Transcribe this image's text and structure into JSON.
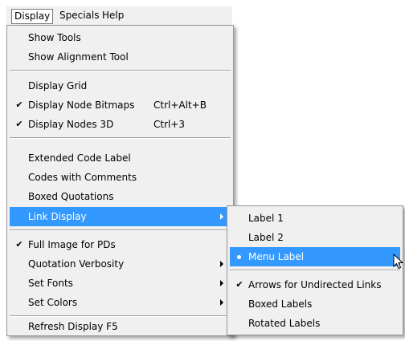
{
  "menubar": {
    "display": "Display",
    "specials": "Specials",
    "help": "Help"
  },
  "display_menu": {
    "show_tools": "Show Tools",
    "show_alignment_tool": "Show Alignment Tool",
    "display_grid": "Display Grid",
    "display_node_bitmaps": {
      "label": "Display Node Bitmaps",
      "accel": "Ctrl+Alt+B",
      "checked": true
    },
    "display_nodes_3d": {
      "label": "Display Nodes 3D",
      "accel": "Ctrl+3",
      "checked": true
    },
    "extended_code_label": "Extended Code Label",
    "codes_with_comments": "Codes with Comments",
    "boxed_quotations": "Boxed Quotations",
    "link_display": "Link Display",
    "full_image_for_pds": {
      "label": "Full Image for PDs",
      "checked": true
    },
    "quotation_verbosity": "Quotation Verbosity",
    "set_fonts": "Set Fonts",
    "set_colors": "Set Colors",
    "refresh_display": "Refresh Display  F5"
  },
  "link_display_submenu": {
    "label_1": "Label 1",
    "label_2": "Label 2",
    "menu_label": {
      "label": "Menu Label",
      "selected": true
    },
    "arrows_for_undirected_links": {
      "label": "Arrows for Undirected Links",
      "checked": true
    },
    "boxed_labels": "Boxed Labels",
    "rotated_labels": "Rotated Labels"
  },
  "colors": {
    "highlight": "#3399ff",
    "menu_bg": "#f0f0f0"
  },
  "icons": {
    "check": "checkmark-icon",
    "bullet": "radio-bullet-icon",
    "submenu": "submenu-arrow-icon",
    "cursor": "mouse-pointer-icon"
  }
}
